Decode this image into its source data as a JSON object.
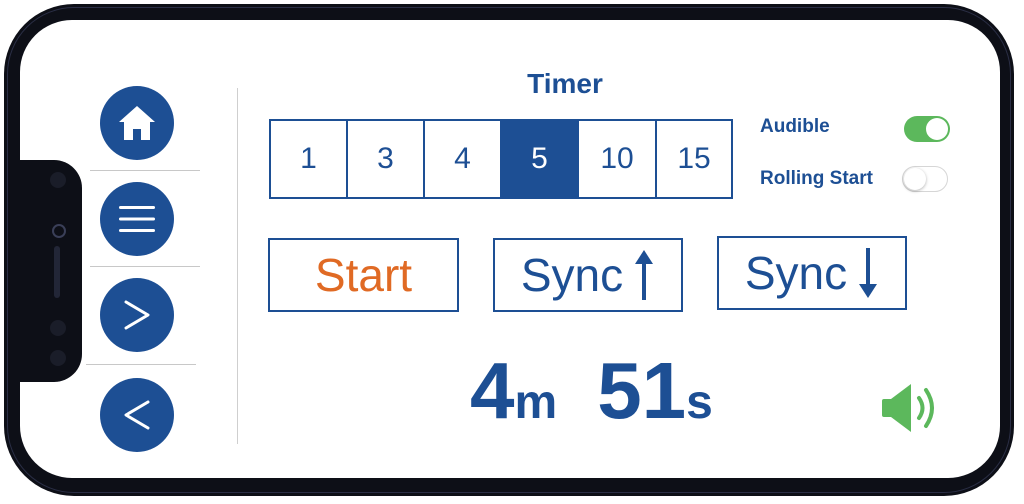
{
  "timer": {
    "title": "Timer",
    "options": [
      "1",
      "3",
      "4",
      "5",
      "10",
      "15"
    ],
    "selected": "5"
  },
  "toggles": {
    "audible": {
      "label": "Audible",
      "on": true
    },
    "rolling_start": {
      "label": "Rolling Start",
      "on": false
    }
  },
  "actions": {
    "start_label": "Start",
    "sync_up_label": "Sync",
    "sync_down_label": "Sync"
  },
  "countdown": {
    "minutes": "4",
    "minutes_unit": "m",
    "seconds": "51",
    "seconds_unit": "s"
  },
  "sidebar": {
    "icons": [
      "home-icon",
      "menu-icon",
      "chevron-right-icon",
      "chevron-left-icon"
    ]
  },
  "colors": {
    "primary": "#1d4f94",
    "start": "#e06a24",
    "toggle_on": "#5cb85c",
    "speaker": "#5cb85c"
  }
}
